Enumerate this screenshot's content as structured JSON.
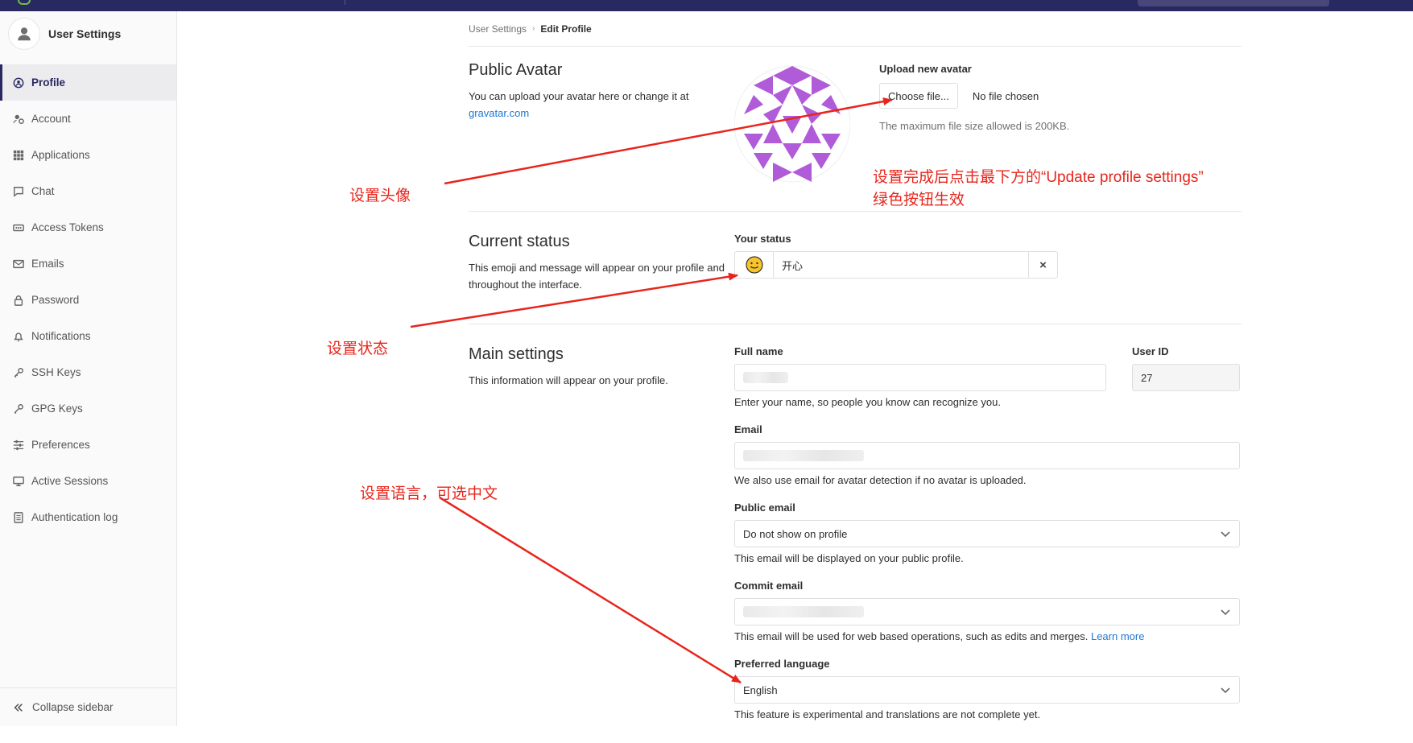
{
  "sidebar": {
    "title": "User Settings",
    "items": [
      {
        "label": "Profile",
        "icon": "profile-icon"
      },
      {
        "label": "Account",
        "icon": "account-icon"
      },
      {
        "label": "Applications",
        "icon": "applications-icon"
      },
      {
        "label": "Chat",
        "icon": "chat-icon"
      },
      {
        "label": "Access Tokens",
        "icon": "access-tokens-icon"
      },
      {
        "label": "Emails",
        "icon": "email-icon"
      },
      {
        "label": "Password",
        "icon": "lock-icon"
      },
      {
        "label": "Notifications",
        "icon": "bell-icon"
      },
      {
        "label": "SSH Keys",
        "icon": "key-icon"
      },
      {
        "label": "GPG Keys",
        "icon": "key-icon"
      },
      {
        "label": "Preferences",
        "icon": "preferences-icon"
      },
      {
        "label": "Active Sessions",
        "icon": "monitor-icon"
      },
      {
        "label": "Authentication log",
        "icon": "log-icon"
      }
    ],
    "collapse_label": "Collapse sidebar"
  },
  "breadcrumb": {
    "parent": "User Settings",
    "current": "Edit Profile"
  },
  "avatar": {
    "title": "Public Avatar",
    "desc": "You can upload your avatar here or change it at",
    "link": "gravatar.com",
    "upload_label": "Upload new avatar",
    "choose_button": "Choose file...",
    "no_file": "No file chosen",
    "max_size_help": "The maximum file size allowed is 200KB."
  },
  "status": {
    "title": "Current status",
    "desc": "This emoji and message will appear on your profile and throughout the interface.",
    "field_label": "Your status",
    "emoji": "😊",
    "message": "开心",
    "clear": "×"
  },
  "main": {
    "title": "Main settings",
    "desc": "This information will appear on your profile.",
    "full_name_label": "Full name",
    "full_name_help": "Enter your name, so people you know can recognize you.",
    "user_id_label": "User ID",
    "user_id_value": "27",
    "email_label": "Email",
    "email_help": "We also use email for avatar detection if no avatar is uploaded.",
    "public_email_label": "Public email",
    "public_email_value": "Do not show on profile",
    "public_email_help": "This email will be displayed on your public profile.",
    "commit_email_label": "Commit email",
    "commit_email_help": "This email will be used for web based operations, such as edits and merges.",
    "learn_more": "Learn more",
    "language_label": "Preferred language",
    "language_value": "English",
    "language_help": "This feature is experimental and translations are not complete yet."
  },
  "annotations": {
    "avatar": "设置头像",
    "status": "设置状态",
    "language": "设置语言，可选中文",
    "note_line1": "设置完成后点击最下方的“Update profile settings”",
    "note_line2": "绿色按钮生效"
  },
  "colors": {
    "topbar": "#292961",
    "annotation": "#e8251c",
    "link": "#1f78d1",
    "avatar_identicon": "#b05bd8"
  }
}
